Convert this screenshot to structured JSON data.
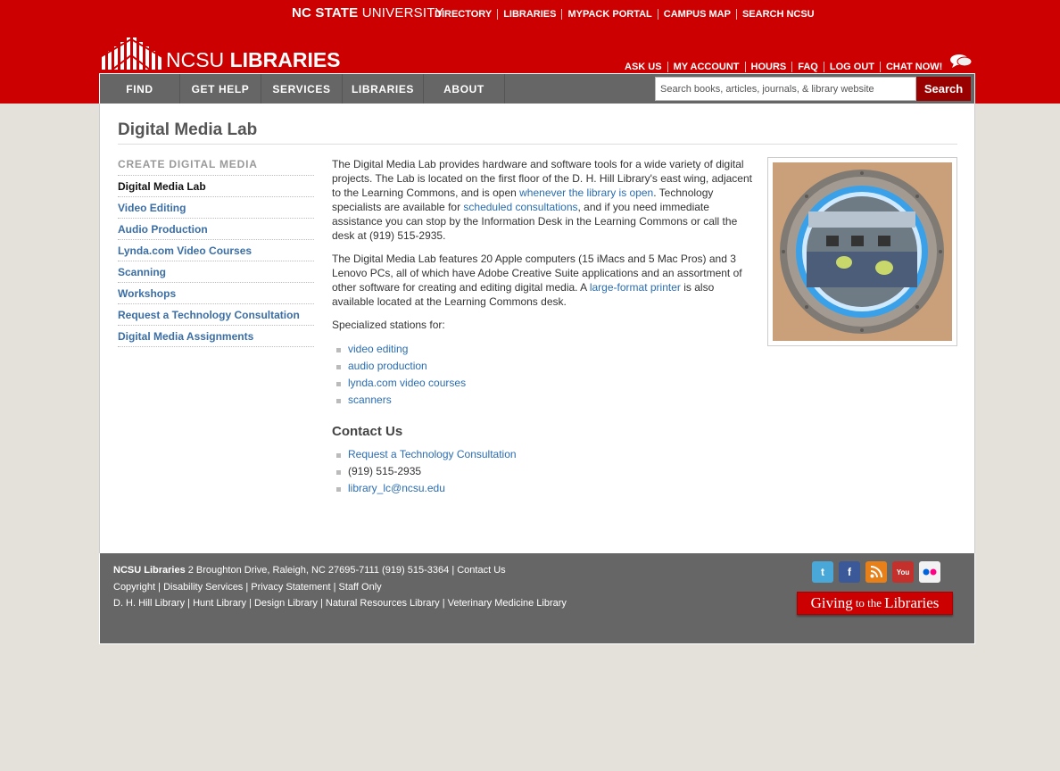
{
  "header": {
    "university_bold": "NC STATE",
    "university_rest": " UNIVERSITY",
    "top_links": [
      "DIRECTORY",
      "LIBRARIES",
      "MYPACK PORTAL",
      "CAMPUS MAP",
      "SEARCH NCSU"
    ],
    "logo_light": "NCSU ",
    "logo_bold": "LIBRARIES",
    "account_links": [
      "ASK US",
      "MY ACCOUNT",
      "HOURS",
      "FAQ",
      "LOG OUT",
      "CHAT NOW!"
    ]
  },
  "nav": {
    "tabs": [
      "FIND",
      "GET HELP",
      "SERVICES",
      "LIBRARIES",
      "ABOUT"
    ],
    "search_placeholder": "Search books, articles, journals, & library website",
    "search_button": "Search"
  },
  "page": {
    "title": "Digital Media Lab"
  },
  "sidebar": {
    "heading": "CREATE DIGITAL MEDIA",
    "items": [
      {
        "label": "Digital Media Lab"
      },
      {
        "label": "Video Editing"
      },
      {
        "label": "Audio Production"
      },
      {
        "label": "Lynda.com Video Courses"
      },
      {
        "label": "Scanning"
      },
      {
        "label": "Workshops"
      },
      {
        "label": "Request a Technology Consultation"
      },
      {
        "label": "Digital Media Assignments"
      }
    ]
  },
  "content": {
    "p1_a": "The Digital Media Lab provides hardware and software tools for a wide variety of digital projects. The Lab is located on the first floor of the D. H. Hill Library's east wing, adjacent to the Learning Commons, and is open ",
    "p1_link1": "whenever the library is open",
    "p1_b": ". Technology specialists are available for ",
    "p1_link2": "scheduled consultations",
    "p1_c": ", and if you need immediate assistance you can stop by the Information Desk in the Learning Commons or call the desk at (919) 515-2935.",
    "p2_a": "The Digital Media Lab features 20 Apple computers (15 iMacs and 5 Mac Pros) and 3 Lenovo PCs, all of which have Adobe Creative Suite applications and an assortment of other software for creating and editing digital media.  A ",
    "p2_link": "large-format printer",
    "p2_b": " is also available located at the Learning Commons desk.",
    "p3": "Specialized stations for:",
    "stations": [
      "video editing",
      "audio production",
      "lynda.com video courses",
      "scanners"
    ],
    "contact_heading": "Contact Us",
    "contact_link": "Request a Technology Consultation",
    "contact_phone": "(919) 515-2935",
    "contact_email": "library_lc@ncsu.edu"
  },
  "footer": {
    "org": "NCSU Libraries",
    "address": " 2 Broughton Drive, Raleigh, NC 27695-7111 (919) 515-3364 | ",
    "contact": "Contact Us",
    "line2": [
      "Copyright",
      "Disability Services",
      "Privacy Statement",
      "Staff Only"
    ],
    "line3": [
      "D. H. Hill Library",
      "Hunt Library",
      "Design Library",
      "Natural Resources Library",
      "Veterinary Medicine Library"
    ],
    "giving_a": "Giving",
    "giving_b": "to the",
    "giving_c": "Libraries"
  },
  "icons": {
    "social": [
      "twitter-icon",
      "facebook-icon",
      "rss-icon",
      "youtube-icon",
      "flickr-icon"
    ]
  },
  "colors": {
    "brand_red": "#cc0000",
    "nav_gray": "#666666",
    "link_blue": "#2a6db0",
    "page_bg": "#e3e1d9"
  }
}
